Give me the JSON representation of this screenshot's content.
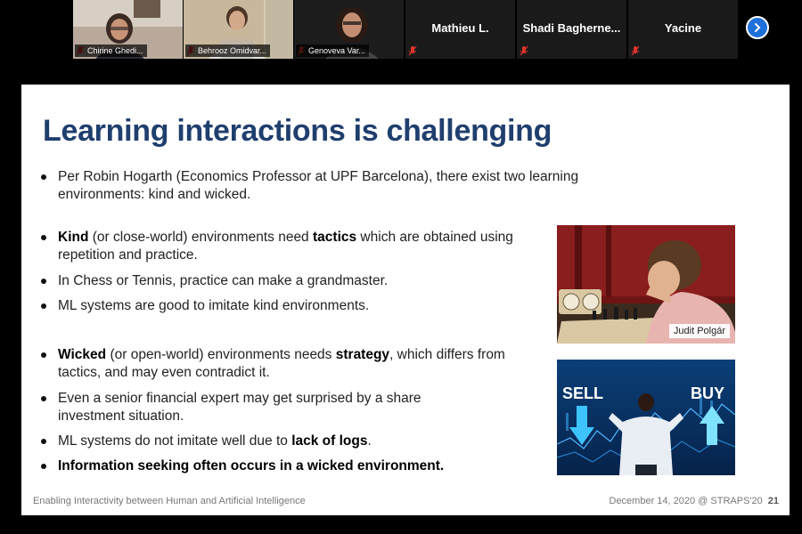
{
  "participants": [
    {
      "name": "Chirine Ghedi...",
      "type": "video"
    },
    {
      "name": "Behrooz Omidvar...",
      "type": "video"
    },
    {
      "name": "Genoveva Var...",
      "type": "video"
    },
    {
      "name": "Mathieu L.",
      "type": "name"
    },
    {
      "name": "Shadi Bagherne...",
      "type": "name"
    },
    {
      "name": "Yacine",
      "type": "name"
    }
  ],
  "slide": {
    "title": "Learning interactions is challenging",
    "intro": "Per Robin Hogarth (Economics Professor at UPF Barcelona), there exist two learning environments: kind and wicked.",
    "kind": {
      "b1_lead": "Kind",
      "b1_mid": " (or close-world) environments need ",
      "b1_bold": "tactics",
      "b1_tail": " which are obtained using repetition and practice.",
      "b2": "In Chess or Tennis, practice can make a grandmaster.",
      "b3": "ML systems are good to imitate kind environments."
    },
    "wicked": {
      "b1_lead": "Wicked",
      "b1_mid": " (or open-world) environments needs ",
      "b1_bold": "strategy",
      "b1_tail": ", which differs from  tactics, and may even contradict it.",
      "b2": "Even a senior financial expert may get surprised by a share investment situation.",
      "b3_pre": "ML systems do not imitate well due to ",
      "b3_bold": "lack of logs",
      "b3_post": ".",
      "b4": "Information seeking often occurs in a wicked environment."
    },
    "photo1_caption": "Judit Polgár",
    "photo2_sell": "SELL",
    "photo2_buy": "BUY",
    "footer_left": "Enabling Interactivity between Human and Artificial Intelligence",
    "footer_right": "December 14, 2020 @ STRAPS'20",
    "page_number": "21"
  },
  "colors": {
    "title": "#1f3f6e",
    "accent_blue": "#1f6fd8",
    "mic_red": "#e0342c"
  }
}
